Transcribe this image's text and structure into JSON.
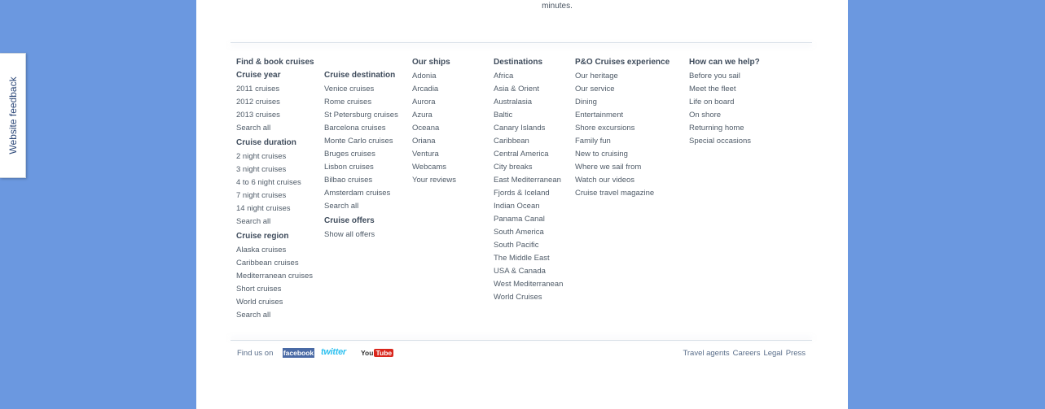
{
  "top_text": "minutes.",
  "feedback_tab": "Website feedback",
  "find_book": {
    "heading": "Find & book cruises",
    "cruise_year": {
      "title": "Cruise year",
      "links": [
        "2011 cruises",
        "2012 cruises",
        "2013 cruises",
        "Search all"
      ]
    },
    "cruise_duration": {
      "title": "Cruise duration",
      "links": [
        "2 night cruises",
        "3 night cruises",
        "4 to 6 night cruises",
        "7 night cruises",
        "14 night cruises",
        "Search all"
      ]
    },
    "cruise_region": {
      "title": "Cruise region",
      "links": [
        "Alaska cruises",
        "Caribbean cruises",
        "Mediterranean cruises",
        "Short cruises",
        "World cruises",
        "Search all"
      ]
    },
    "cruise_destination": {
      "title": "Cruise destination",
      "links": [
        "Venice cruises",
        "Rome cruises",
        "St Petersburg cruises",
        "Barcelona cruises",
        "Monte Carlo cruises",
        "Bruges cruises",
        "Lisbon cruises",
        "Bilbao cruises",
        "Amsterdam cruises",
        "Search all"
      ]
    },
    "cruise_offers": {
      "title": "Cruise offers",
      "links": [
        "Show all offers"
      ]
    }
  },
  "our_ships": {
    "heading": "Our ships",
    "links": [
      "Adonia",
      "Arcadia",
      "Aurora",
      "Azura",
      "Oceana",
      "Oriana",
      "Ventura",
      "Webcams",
      "Your reviews"
    ]
  },
  "destinations": {
    "heading": "Destinations",
    "links": [
      "Africa",
      "Asia & Orient",
      "Australasia",
      "Baltic",
      "Canary Islands",
      "Caribbean",
      "Central America",
      "City breaks",
      "East Mediterranean",
      "Fjords & Iceland",
      "Indian Ocean",
      "Panama Canal",
      "South America",
      "South Pacific",
      "The Middle East",
      "USA & Canada",
      "West Mediterranean",
      "World Cruises"
    ]
  },
  "experience": {
    "heading": "P&O Cruises experience",
    "links": [
      "Our heritage",
      "Our service",
      "Dining",
      "Entertainment",
      "Shore excursions",
      "Family fun",
      "New to cruising",
      "Where we sail from",
      "Watch our videos",
      "Cruise travel magazine"
    ]
  },
  "help": {
    "heading": "How can we help?",
    "links": [
      "Before you sail",
      "Meet the fleet",
      "Life on board",
      "On shore",
      "Returning home",
      "Special occasions"
    ]
  },
  "footer": {
    "find_us": "Find us on",
    "facebook": "facebook",
    "twitter": "twitter",
    "youtube_you": "You",
    "youtube_tube": "Tube",
    "right_links": [
      "Travel agents",
      "Careers",
      "Legal",
      "Press"
    ]
  },
  "colors": {
    "background": "#6b98e0",
    "page": "#ffffff",
    "text": "#4f5b68",
    "heading": "#3f4c5c"
  }
}
